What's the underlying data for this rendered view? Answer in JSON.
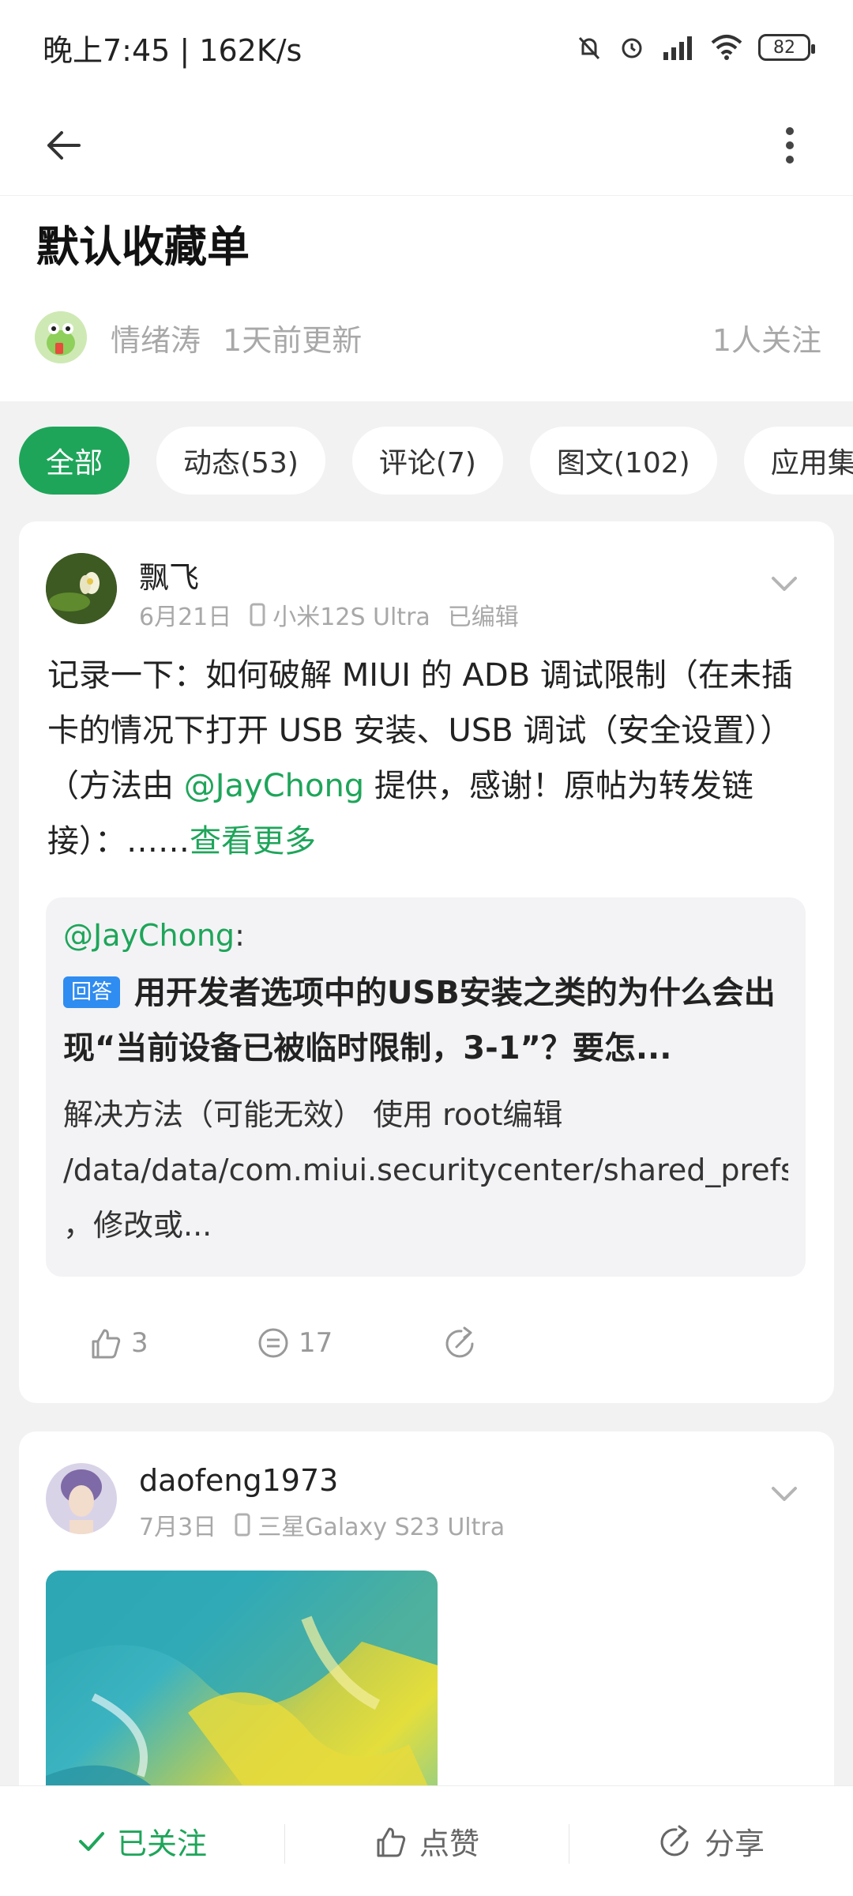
{
  "status": {
    "time": "晚上7:45 | 162K/s",
    "battery": "82"
  },
  "header": {
    "title": "默认收藏单",
    "owner": "情绪涛",
    "updated": "1天前更新",
    "followers": "1人关注"
  },
  "tabs": [
    {
      "label": "全部"
    },
    {
      "label": "动态(53)"
    },
    {
      "label": "评论(7)"
    },
    {
      "label": "图文(102)"
    },
    {
      "label": "应用集("
    }
  ],
  "posts": [
    {
      "author": "飘飞",
      "date": "6月21日",
      "device": "小米12S Ultra",
      "edited": "已编辑",
      "text_1": "记录一下：如何破解 MIUI 的 ADB 调试限制（在未插卡的情况下打开 USB 安装、USB 调试（安全设置））（方法由 ",
      "mention": "@JayChong",
      "text_2": " 提供，感谢！原帖为转发链接）：……",
      "more": "查看更多",
      "quote": {
        "mention": "@JayChong",
        "colon": ":",
        "badge": "回答",
        "title": "用开发者选项中的USB安装之类的为什么会出现“当前设备已被临时限制，3-1”？要怎...",
        "body": "解决方法（可能无效） 使用 root编辑 /data/data/com.miui.securitycenter/shared_prefs/remote_provider_preferences.xml ，修改或..."
      },
      "likes": "3",
      "comments": "17"
    },
    {
      "author": "daofeng1973",
      "date": "7月3日",
      "device": "三星Galaxy S23 Ultra"
    }
  ],
  "bottom": {
    "follow": "已关注",
    "like": "点赞",
    "share": "分享"
  },
  "colors": {
    "accent": "#1ea55a",
    "badge": "#2f8cf0"
  }
}
